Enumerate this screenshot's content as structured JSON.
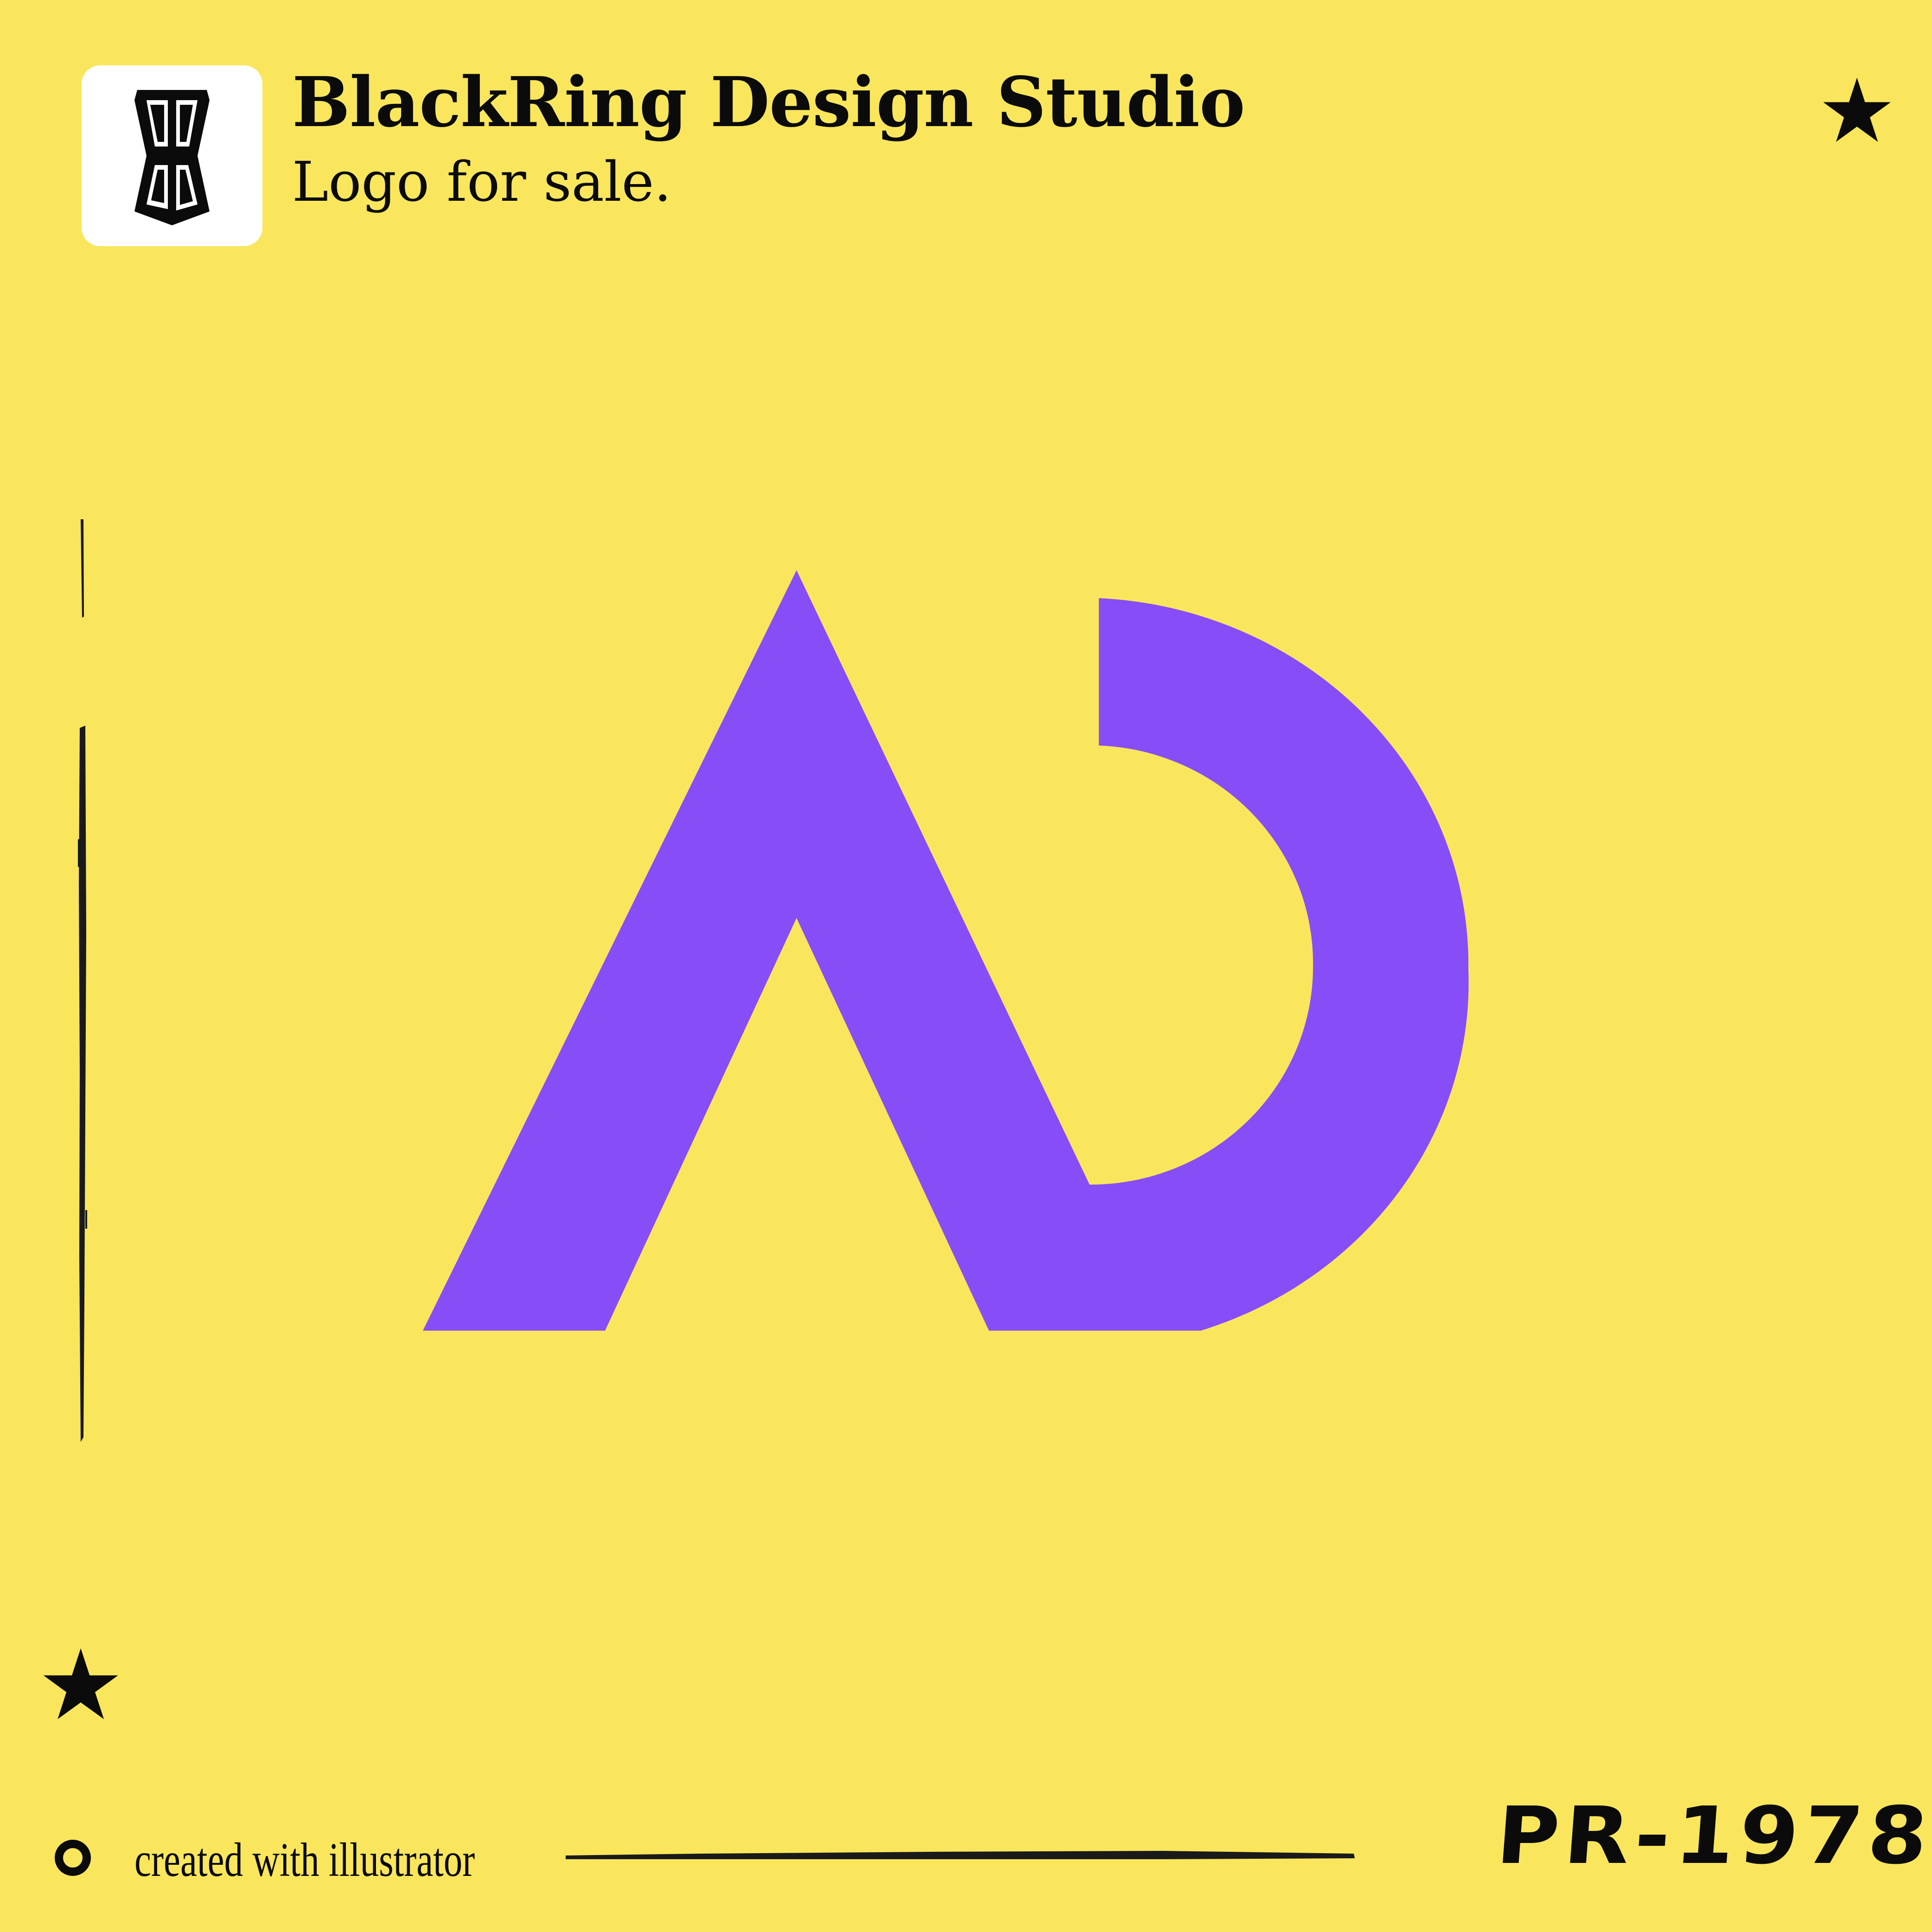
{
  "header": {
    "studio_name": "BlackRing Design Studio",
    "tagline": "Logo for sale."
  },
  "badge": {
    "icon": "br-monogram-icon",
    "monogram": "BR"
  },
  "logo_mark": {
    "icon": "ad-monogram-mark",
    "color": "#874DF6"
  },
  "footer": {
    "credit": "created with illustrator",
    "product_code": "PR-1978"
  },
  "colors": {
    "background": "#F9E65C",
    "ink": "#0B0B0B",
    "badge_background": "#FFFFFF",
    "accent": "#874DF6"
  }
}
